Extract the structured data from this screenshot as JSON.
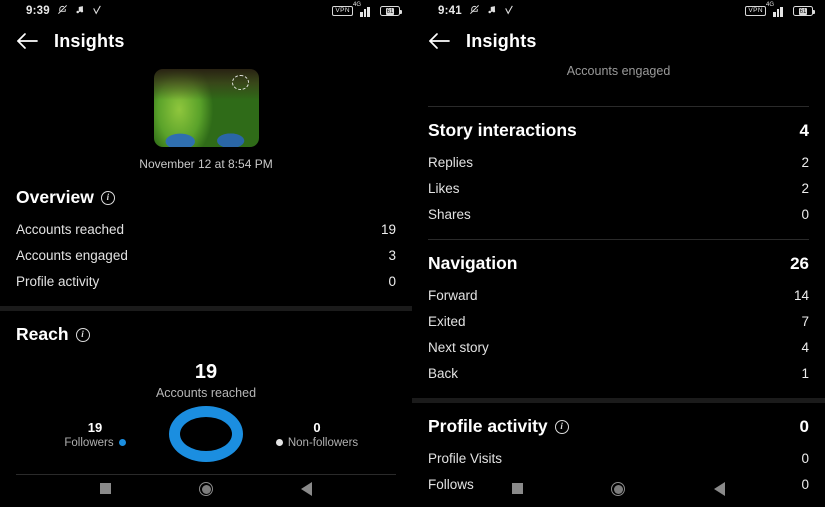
{
  "left": {
    "status": {
      "time": "9:39",
      "icons": [
        "bell-muted-icon",
        "music-note-icon",
        "chevron-glyph-icon"
      ],
      "vpn": "VPN",
      "net_gen": "4G",
      "battery": "61"
    },
    "appbar": {
      "title": "Insights",
      "back": "back-arrow-icon"
    },
    "media": {
      "date": "November 12 at 8:54 PM"
    },
    "overview": {
      "title": "Overview",
      "rows": [
        {
          "label": "Accounts reached",
          "value": "19"
        },
        {
          "label": "Accounts engaged",
          "value": "3"
        },
        {
          "label": "Profile activity",
          "value": "0"
        }
      ]
    },
    "reach": {
      "title": "Reach",
      "big_value": "19",
      "big_label": "Accounts reached",
      "followers_value": "19",
      "followers_label": "Followers",
      "nonfollowers_value": "0",
      "nonfollowers_label": "Non-followers"
    }
  },
  "right": {
    "status": {
      "time": "9:41",
      "vpn": "VPN",
      "net_gen": "4G",
      "battery": "61"
    },
    "appbar": {
      "title": "Insights",
      "subtitle": "Accounts engaged"
    },
    "story_interactions": {
      "title": "Story interactions",
      "value": "4",
      "rows": [
        {
          "label": "Replies",
          "value": "2"
        },
        {
          "label": "Likes",
          "value": "2"
        },
        {
          "label": "Shares",
          "value": "0"
        }
      ]
    },
    "navigation": {
      "title": "Navigation",
      "value": "26",
      "rows": [
        {
          "label": "Forward",
          "value": "14"
        },
        {
          "label": "Exited",
          "value": "7"
        },
        {
          "label": "Next story",
          "value": "4"
        },
        {
          "label": "Back",
          "value": "1"
        }
      ]
    },
    "profile_activity": {
      "title": "Profile activity",
      "value": "0",
      "rows": [
        {
          "label": "Profile Visits",
          "value": "0"
        },
        {
          "label": "Follows",
          "value": "0"
        }
      ]
    }
  },
  "colors": {
    "accent_blue": "#1b8ee0",
    "background": "#000000",
    "text": "#ffffff",
    "muted": "#b0b0b0"
  },
  "chart_data": {
    "type": "pie",
    "title": "Accounts reached",
    "categories": [
      "Followers",
      "Non-followers"
    ],
    "values": [
      19,
      0
    ],
    "total": 19,
    "colors": [
      "#1b8ee0",
      "#dddddd"
    ],
    "legend": "sides",
    "grid": false
  }
}
